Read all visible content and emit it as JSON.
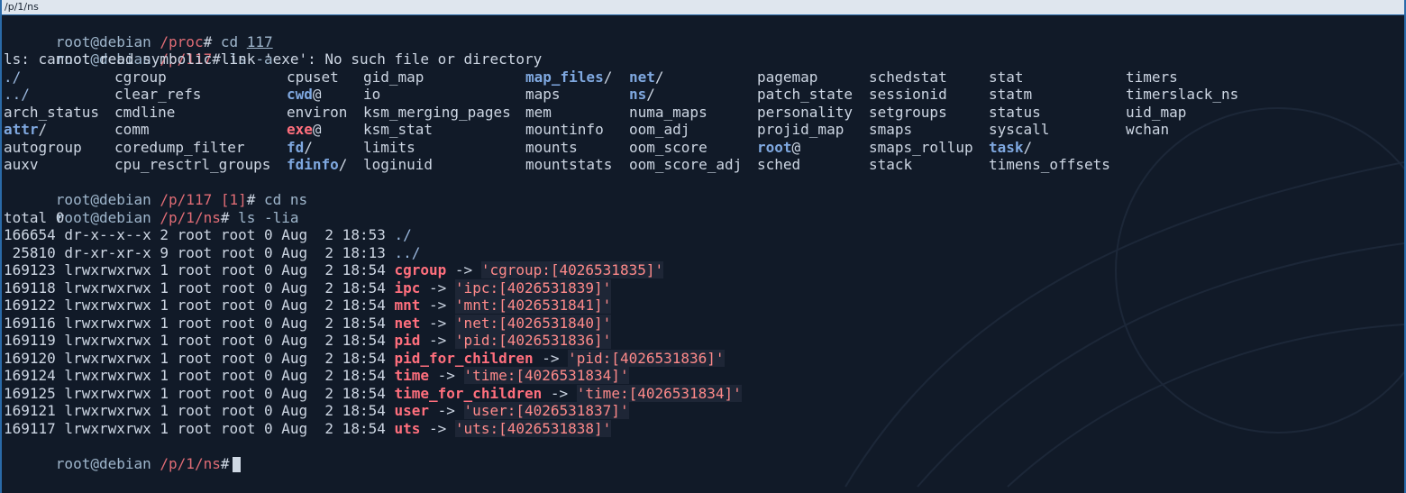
{
  "window": {
    "title": "/p/1/ns"
  },
  "prompts": [
    {
      "user": "root",
      "host": "debian",
      "dir": "/proc",
      "jobs": "",
      "sign": "#",
      "cmd": " cd ",
      "arg": "117"
    },
    {
      "user": "root",
      "host": "debian",
      "dir": "/p/117",
      "jobs": "",
      "sign": "#",
      "cmd": " ls -a",
      "arg": ""
    },
    {
      "user": "root",
      "host": "debian",
      "dir": "/p/117",
      "jobs": " [1]",
      "sign": "#",
      "cmd": " cd ns",
      "arg": ""
    },
    {
      "user": "root",
      "host": "debian",
      "dir": "/p/1/ns",
      "jobs": "",
      "sign": "#",
      "cmd": " ls -lia",
      "arg": ""
    },
    {
      "user": "root",
      "host": "debian",
      "dir": "/p/1/ns",
      "jobs": "",
      "sign": "#",
      "cmd": " ",
      "arg": ""
    }
  ],
  "error_line": "ls: cannot read symbolic link 'exe': No such file or directory",
  "ls_columns": [
    [
      {
        "name": "./",
        "kind": "dir"
      },
      {
        "name": "../",
        "kind": "dir"
      },
      {
        "name": "arch_status",
        "kind": "file"
      },
      {
        "name": "attr/",
        "kind": "dir"
      },
      {
        "name": "autogroup",
        "kind": "file"
      },
      {
        "name": "auxv",
        "kind": "file"
      }
    ],
    [
      {
        "name": "cgroup",
        "kind": "file"
      },
      {
        "name": "clear_refs",
        "kind": "file"
      },
      {
        "name": "cmdline",
        "kind": "file"
      },
      {
        "name": "comm",
        "kind": "file"
      },
      {
        "name": "coredump_filter",
        "kind": "file"
      },
      {
        "name": "cpu_resctrl_groups",
        "kind": "file"
      }
    ],
    [
      {
        "name": "cpuset",
        "kind": "file"
      },
      {
        "name": "cwd@",
        "kind": "link"
      },
      {
        "name": "environ",
        "kind": "file"
      },
      {
        "name": "exe@",
        "kind": "broken"
      },
      {
        "name": "fd/",
        "kind": "dir"
      },
      {
        "name": "fdinfo/",
        "kind": "dir"
      }
    ],
    [
      {
        "name": "gid_map",
        "kind": "file"
      },
      {
        "name": "io",
        "kind": "file"
      },
      {
        "name": "ksm_merging_pages",
        "kind": "file"
      },
      {
        "name": "ksm_stat",
        "kind": "file"
      },
      {
        "name": "limits",
        "kind": "file"
      },
      {
        "name": "loginuid",
        "kind": "file"
      }
    ],
    [
      {
        "name": "map_files/",
        "kind": "dir"
      },
      {
        "name": "maps",
        "kind": "file"
      },
      {
        "name": "mem",
        "kind": "file"
      },
      {
        "name": "mountinfo",
        "kind": "file"
      },
      {
        "name": "mounts",
        "kind": "file"
      },
      {
        "name": "mountstats",
        "kind": "file"
      }
    ],
    [
      {
        "name": "net/",
        "kind": "dir"
      },
      {
        "name": "ns/",
        "kind": "dir"
      },
      {
        "name": "numa_maps",
        "kind": "file"
      },
      {
        "name": "oom_adj",
        "kind": "file"
      },
      {
        "name": "oom_score",
        "kind": "file"
      },
      {
        "name": "oom_score_adj",
        "kind": "file"
      }
    ],
    [
      {
        "name": "pagemap",
        "kind": "file"
      },
      {
        "name": "patch_state",
        "kind": "file"
      },
      {
        "name": "personality",
        "kind": "file"
      },
      {
        "name": "projid_map",
        "kind": "file"
      },
      {
        "name": "root@",
        "kind": "link"
      },
      {
        "name": "sched",
        "kind": "file"
      }
    ],
    [
      {
        "name": "schedstat",
        "kind": "file"
      },
      {
        "name": "sessionid",
        "kind": "file"
      },
      {
        "name": "setgroups",
        "kind": "file"
      },
      {
        "name": "smaps",
        "kind": "file"
      },
      {
        "name": "smaps_rollup",
        "kind": "file"
      },
      {
        "name": "stack",
        "kind": "file"
      }
    ],
    [
      {
        "name": "stat",
        "kind": "file"
      },
      {
        "name": "statm",
        "kind": "file"
      },
      {
        "name": "status",
        "kind": "file"
      },
      {
        "name": "syscall",
        "kind": "file"
      },
      {
        "name": "task/",
        "kind": "dir"
      },
      {
        "name": "timens_offsets",
        "kind": "file"
      }
    ],
    [
      {
        "name": "timers",
        "kind": "file"
      },
      {
        "name": "timerslack_ns",
        "kind": "file"
      },
      {
        "name": "uid_map",
        "kind": "file"
      },
      {
        "name": "wchan",
        "kind": "file"
      }
    ]
  ],
  "total_line": "total 0",
  "long_listing": [
    {
      "inode": "166654",
      "perms": "dr-x--x--x",
      "links": "2",
      "owner": "root",
      "group": "root",
      "size": "0",
      "month": "Aug",
      "day": " 2",
      "time": "18:53",
      "name": "./",
      "kind": "dir",
      "target": ""
    },
    {
      "inode": " 25810",
      "perms": "dr-xr-xr-x",
      "links": "9",
      "owner": "root",
      "group": "root",
      "size": "0",
      "month": "Aug",
      "day": " 2",
      "time": "18:13",
      "name": "../",
      "kind": "dir",
      "target": ""
    },
    {
      "inode": "169123",
      "perms": "lrwxrwxrwx",
      "links": "1",
      "owner": "root",
      "group": "root",
      "size": "0",
      "month": "Aug",
      "day": " 2",
      "time": "18:54",
      "name": "cgroup",
      "kind": "link",
      "target": "'cgroup:[4026531835]'"
    },
    {
      "inode": "169118",
      "perms": "lrwxrwxrwx",
      "links": "1",
      "owner": "root",
      "group": "root",
      "size": "0",
      "month": "Aug",
      "day": " 2",
      "time": "18:54",
      "name": "ipc",
      "kind": "link",
      "target": "'ipc:[4026531839]'"
    },
    {
      "inode": "169122",
      "perms": "lrwxrwxrwx",
      "links": "1",
      "owner": "root",
      "group": "root",
      "size": "0",
      "month": "Aug",
      "day": " 2",
      "time": "18:54",
      "name": "mnt",
      "kind": "link",
      "target": "'mnt:[4026531841]'"
    },
    {
      "inode": "169116",
      "perms": "lrwxrwxrwx",
      "links": "1",
      "owner": "root",
      "group": "root",
      "size": "0",
      "month": "Aug",
      "day": " 2",
      "time": "18:54",
      "name": "net",
      "kind": "link",
      "target": "'net:[4026531840]'"
    },
    {
      "inode": "169119",
      "perms": "lrwxrwxrwx",
      "links": "1",
      "owner": "root",
      "group": "root",
      "size": "0",
      "month": "Aug",
      "day": " 2",
      "time": "18:54",
      "name": "pid",
      "kind": "link",
      "target": "'pid:[4026531836]'"
    },
    {
      "inode": "169120",
      "perms": "lrwxrwxrwx",
      "links": "1",
      "owner": "root",
      "group": "root",
      "size": "0",
      "month": "Aug",
      "day": " 2",
      "time": "18:54",
      "name": "pid_for_children",
      "kind": "link",
      "target": "'pid:[4026531836]'"
    },
    {
      "inode": "169124",
      "perms": "lrwxrwxrwx",
      "links": "1",
      "owner": "root",
      "group": "root",
      "size": "0",
      "month": "Aug",
      "day": " 2",
      "time": "18:54",
      "name": "time",
      "kind": "link",
      "target": "'time:[4026531834]'"
    },
    {
      "inode": "169125",
      "perms": "lrwxrwxrwx",
      "links": "1",
      "owner": "root",
      "group": "root",
      "size": "0",
      "month": "Aug",
      "day": " 2",
      "time": "18:54",
      "name": "time_for_children",
      "kind": "link",
      "target": "'time:[4026531834]'"
    },
    {
      "inode": "169121",
      "perms": "lrwxrwxrwx",
      "links": "1",
      "owner": "root",
      "group": "root",
      "size": "0",
      "month": "Aug",
      "day": " 2",
      "time": "18:54",
      "name": "user",
      "kind": "link",
      "target": "'user:[4026531837]'"
    },
    {
      "inode": "169117",
      "perms": "lrwxrwxrwx",
      "links": "1",
      "owner": "root",
      "group": "root",
      "size": "0",
      "month": "Aug",
      "day": " 2",
      "time": "18:54",
      "name": "uts",
      "kind": "link",
      "target": "'uts:[4026531838]'"
    }
  ],
  "arrow": " -> ",
  "colors": {
    "background": "#111a28",
    "directory": "#7fa8e0",
    "symlink_name": "#ff6f7d",
    "symlink_target": "#ff8a8a",
    "path": "#e06c75",
    "border": "#2a6aa8"
  }
}
